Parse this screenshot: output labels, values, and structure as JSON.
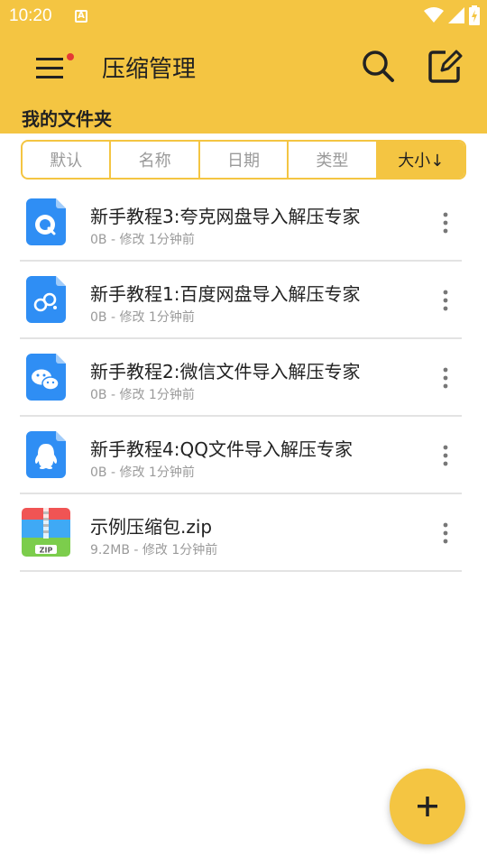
{
  "status": {
    "time": "10:20"
  },
  "app": {
    "title": "压缩管理"
  },
  "folder": {
    "title": "我的文件夹"
  },
  "sort": {
    "tabs": [
      {
        "label": "默认"
      },
      {
        "label": "名称"
      },
      {
        "label": "日期"
      },
      {
        "label": "类型"
      },
      {
        "label": "大小↓"
      }
    ],
    "active": "大小↓"
  },
  "files": [
    {
      "name": "新手教程3:夸克网盘导入解压专家",
      "meta": "0B - 修改 1分钟前",
      "icon": "quark-doc-icon"
    },
    {
      "name": "新手教程1:百度网盘导入解压专家",
      "meta": "0B - 修改 1分钟前",
      "icon": "baidu-doc-icon"
    },
    {
      "name": "新手教程2:微信文件导入解压专家",
      "meta": "0B - 修改 1分钟前",
      "icon": "wechat-doc-icon"
    },
    {
      "name": "新手教程4:QQ文件导入解压专家",
      "meta": "0B - 修改 1分钟前",
      "icon": "qq-doc-icon"
    },
    {
      "name": "示例压缩包.zip",
      "meta": "9.2MB - 修改 1分钟前",
      "icon": "zip-file-icon",
      "icon_label": "ZIP"
    }
  ],
  "colors": {
    "accent": "#f4c542",
    "doc_blue": "#2f8ef4",
    "badge_red": "#e53935"
  }
}
